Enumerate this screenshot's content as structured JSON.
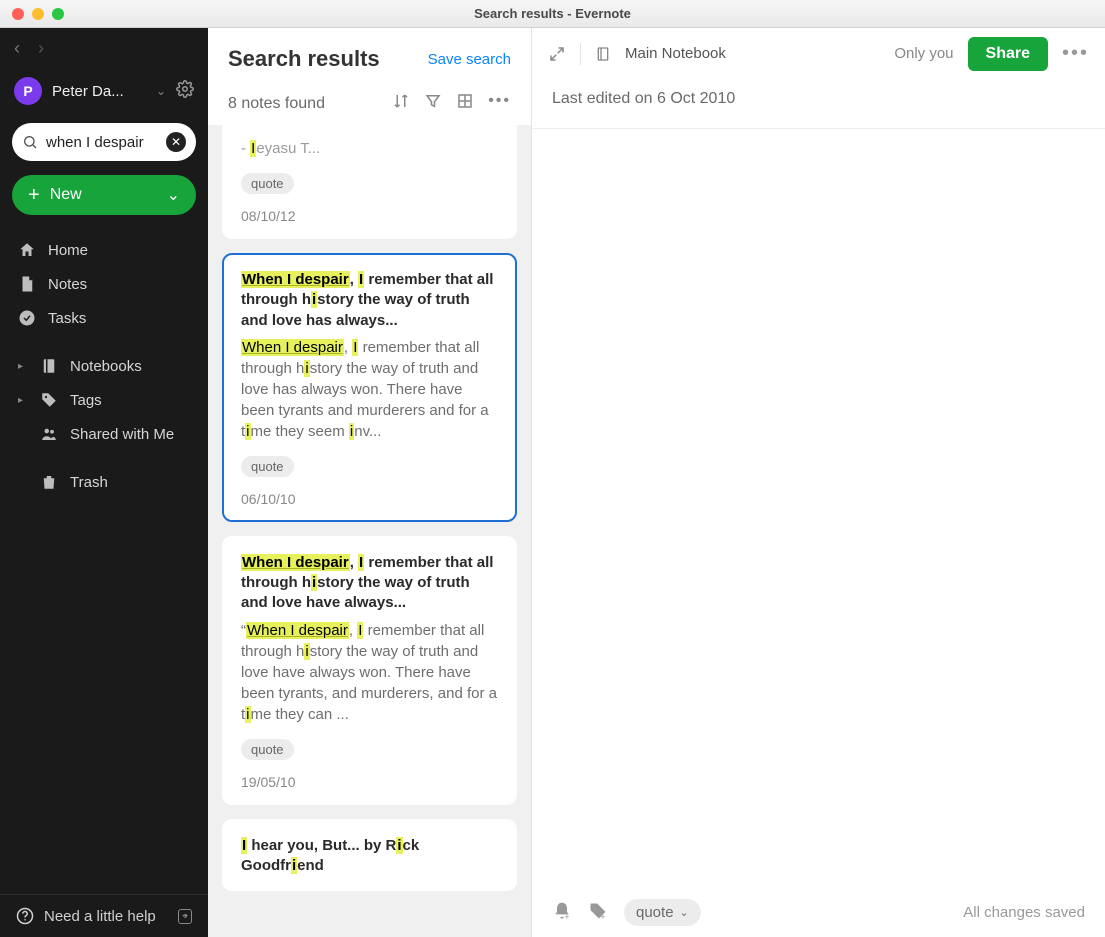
{
  "window": {
    "title": "Search results - Evernote"
  },
  "sidebar": {
    "user": {
      "initial": "P",
      "name": "Peter Da..."
    },
    "search": {
      "value": "when I despair"
    },
    "new_button": {
      "label": "New"
    },
    "items": [
      {
        "label": "Home"
      },
      {
        "label": "Notes"
      },
      {
        "label": "Tasks"
      },
      {
        "label": "Notebooks"
      },
      {
        "label": "Tags"
      },
      {
        "label": "Shared with Me"
      },
      {
        "label": "Trash"
      }
    ],
    "footer": {
      "label": "Need a little help"
    }
  },
  "list": {
    "title": "Search results",
    "save_search": "Save search",
    "count": "8 notes found",
    "items": [
      {
        "partial": true,
        "body_html": "<span style='color:#9a9a9a'> - <mark>I</mark>eyasu T...</span>",
        "tag": "quote",
        "date": "08/10/12"
      },
      {
        "selected": true,
        "title_html": "<mark class='u'>When I despair</mark>, <mark>I</mark> remember that all through h<mark>i</mark>story the way of truth and love has always...",
        "body_html": "<mark class='u'>When I despair</mark>, <mark>I</mark> remember that all through h<mark>i</mark>story the way of truth and love has always won. There have been tyrants and murderers and for a t<mark>i</mark>me they seem <mark>i</mark>nv...",
        "tag": "quote",
        "date": "06/10/10"
      },
      {
        "title_html": "<mark class='u'>When I despair</mark>, <mark>I</mark> remember that all through h<mark>i</mark>story the way of truth and love have always...",
        "body_html": "“<mark class='u'>When I despair</mark>, <mark>I</mark> remember that all through h<mark>i</mark>story the way of truth and love have always won. There have been tyrants, and murderers, and for a t<mark>i</mark>me they can ...",
        "tag": "quote",
        "date": "19/05/10"
      },
      {
        "title_html": "<mark>I</mark> hear you, But... by R<mark>i</mark>ck Goodfr<mark>i</mark>end",
        "body_html": "",
        "tag": "",
        "date": ""
      }
    ]
  },
  "detail": {
    "notebook": "Main Notebook",
    "only_you": "Only you",
    "share": "Share",
    "last_edited": "Last edited on 6 Oct 2010",
    "footer_tag": "quote",
    "saved": "All changes saved"
  }
}
